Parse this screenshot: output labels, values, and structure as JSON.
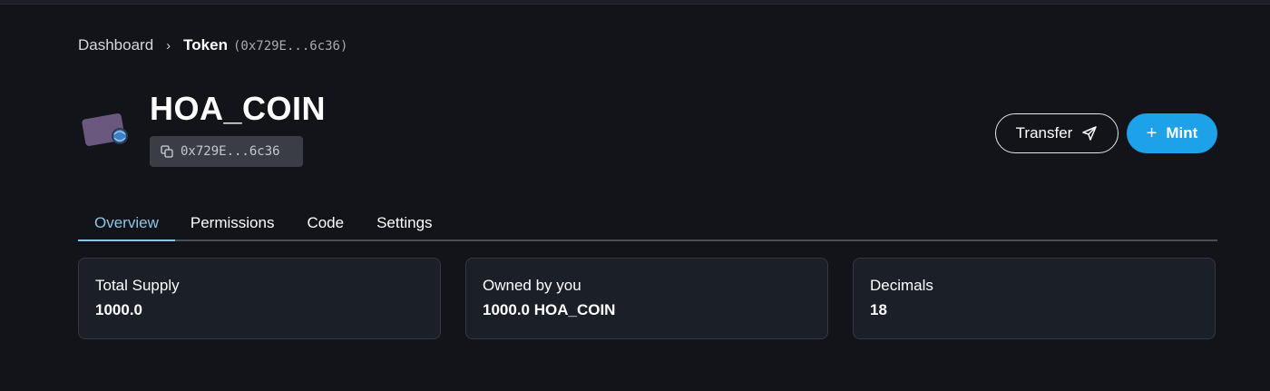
{
  "breadcrumb": {
    "root": "Dashboard",
    "separator": "›",
    "current": "Token",
    "address": "(0x729E...6c36)"
  },
  "token": {
    "name": "HOA_COIN",
    "short_address": "0x729E...6c36"
  },
  "actions": {
    "transfer_label": "Transfer",
    "mint_label": "Mint"
  },
  "tabs": [
    {
      "label": "Overview",
      "active": true
    },
    {
      "label": "Permissions",
      "active": false
    },
    {
      "label": "Code",
      "active": false
    },
    {
      "label": "Settings",
      "active": false
    }
  ],
  "stats": [
    {
      "label": "Total Supply",
      "value": "1000.0"
    },
    {
      "label": "Owned by you",
      "value": "1000.0 HOA_COIN"
    },
    {
      "label": "Decimals",
      "value": "18"
    }
  ],
  "colors": {
    "background": "#12141a",
    "accent": "#1da1e8",
    "active_tab": "#8ec4e6",
    "card": "#1b1f27"
  },
  "icons": {
    "logo": "token-card-icon",
    "copy": "copy-icon",
    "send": "send-icon",
    "plus": "plus-icon"
  }
}
